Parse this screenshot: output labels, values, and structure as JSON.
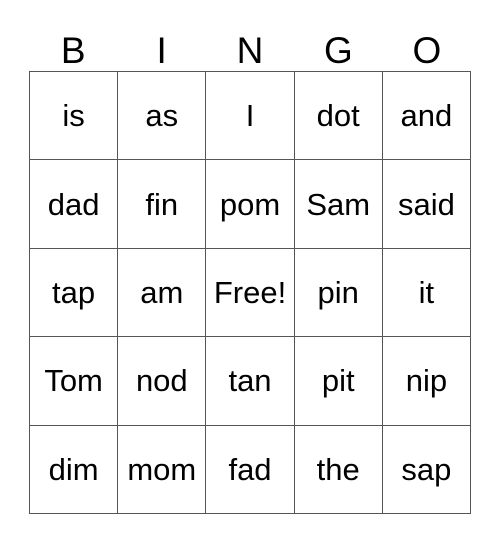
{
  "card": {
    "headers": [
      "B",
      "I",
      "N",
      "G",
      "O"
    ],
    "rows": [
      [
        "is",
        "as",
        "I",
        "dot",
        "and"
      ],
      [
        "dad",
        "fin",
        "pom",
        "Sam",
        "said"
      ],
      [
        "tap",
        "am",
        "Free!",
        "pin",
        "it"
      ],
      [
        "Tom",
        "nod",
        "tan",
        "pit",
        "nip"
      ],
      [
        "dim",
        "mom",
        "fad",
        "the",
        "sap"
      ]
    ],
    "free_space": "Free!",
    "colors": {
      "grid_line": "#555555",
      "text": "#000000",
      "background": "#ffffff"
    }
  }
}
